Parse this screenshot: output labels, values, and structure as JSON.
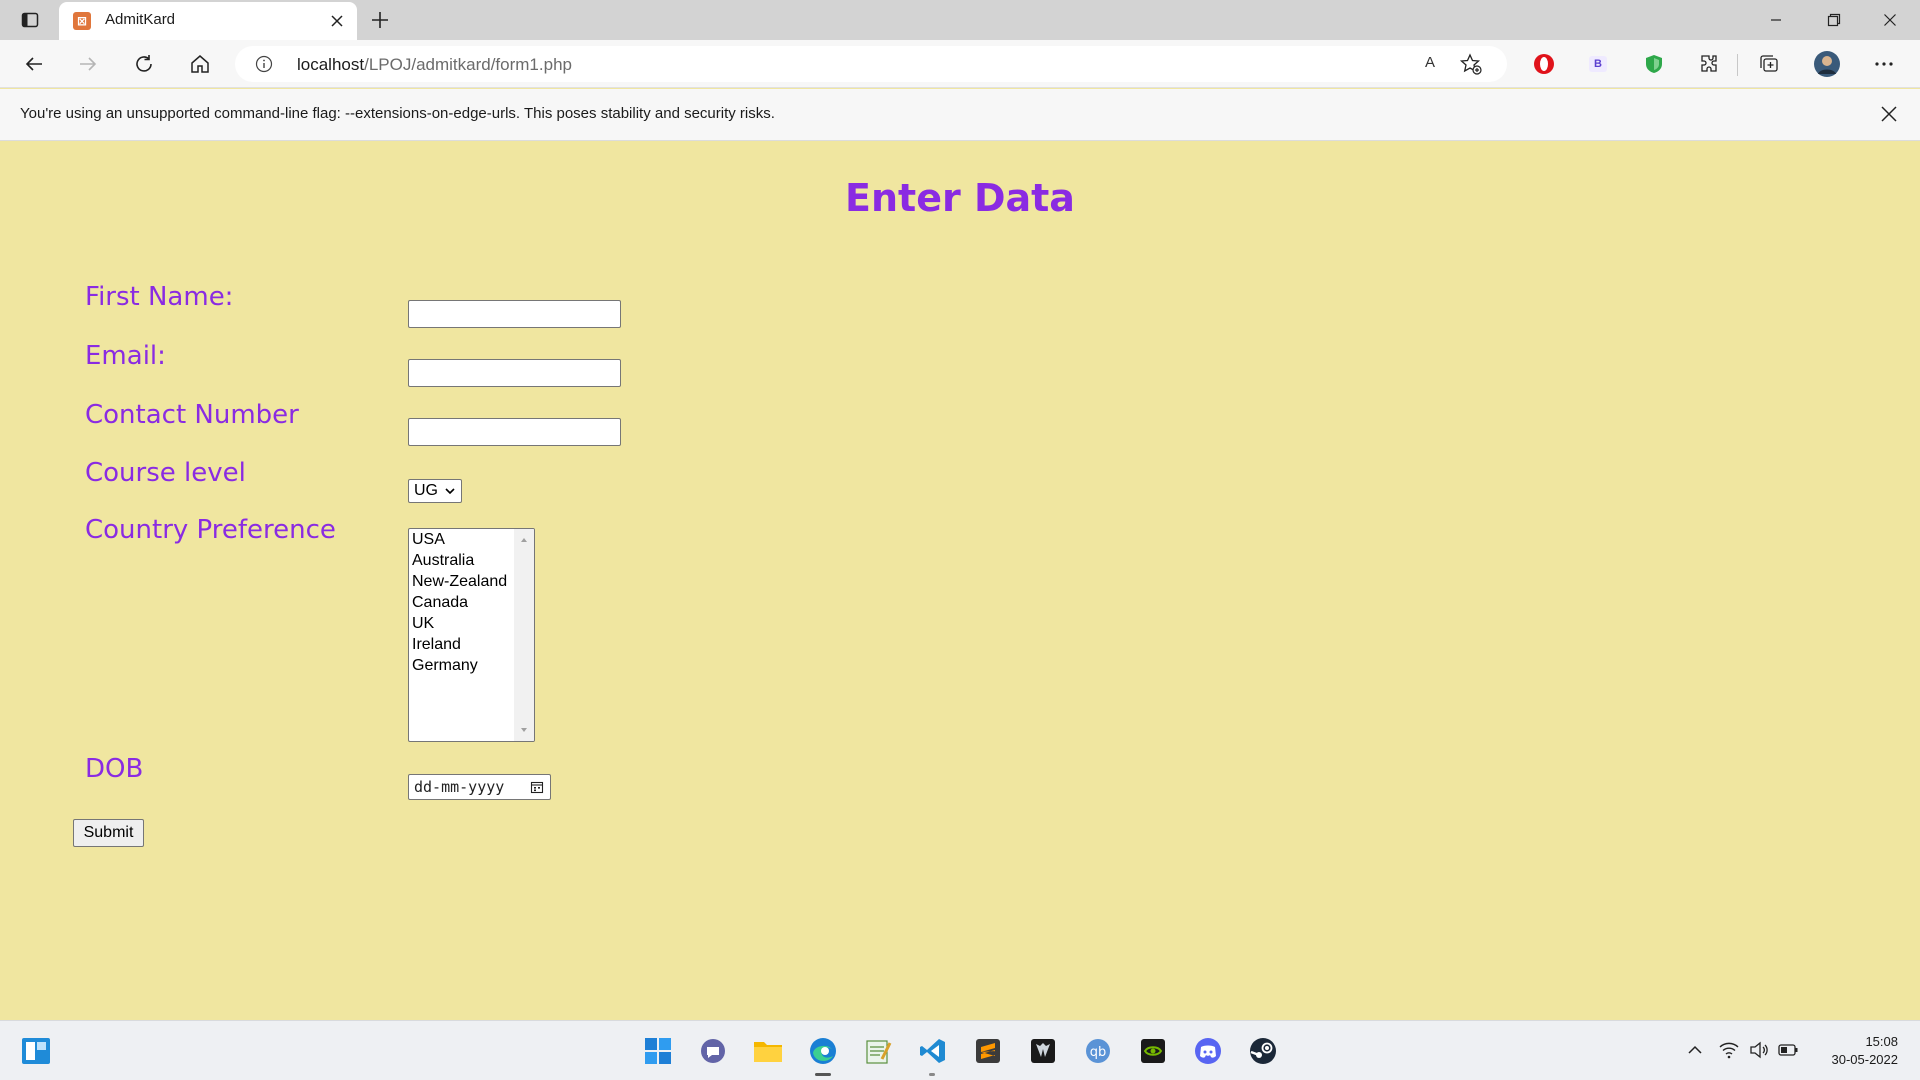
{
  "browser": {
    "tab_title": "AdmitKard",
    "url_host": "localhost",
    "url_path": "/LPOJ/admitkard/form1.php",
    "read_aloud": "A",
    "infobar_message": "You're using an unsupported command-line flag: --extensions-on-edge-urls. This poses stability and security risks.",
    "extension_b": "B"
  },
  "form": {
    "heading": "Enter Data",
    "labels": {
      "first_name": "First Name:",
      "email": "Email:",
      "contact": "Contact Number",
      "course_level": "Course level",
      "country": "Country Preference",
      "dob": "DOB"
    },
    "first_name_value": "",
    "email_value": "",
    "contact_value": "",
    "course_level_selected": "UG",
    "countries": [
      "USA",
      "Australia",
      "New-Zealand",
      "Canada",
      "UK",
      "Ireland",
      "Germany"
    ],
    "dob_placeholder": "dd-mm-yyyy",
    "submit_label": "Submit"
  },
  "taskbar": {
    "time": "15:08",
    "date": "30-05-2022",
    "apps": [
      "start-icon",
      "chat-icon",
      "file-explorer-icon",
      "edge-icon",
      "notepad-icon",
      "vscode-icon",
      "sublime-icon",
      "predator-icon",
      "qbittorrent-icon",
      "nvidia-icon",
      "discord-icon",
      "steam-icon"
    ]
  },
  "colors": {
    "page_bg": "#f0e6a0",
    "accent_purple": "#8a2be2"
  }
}
